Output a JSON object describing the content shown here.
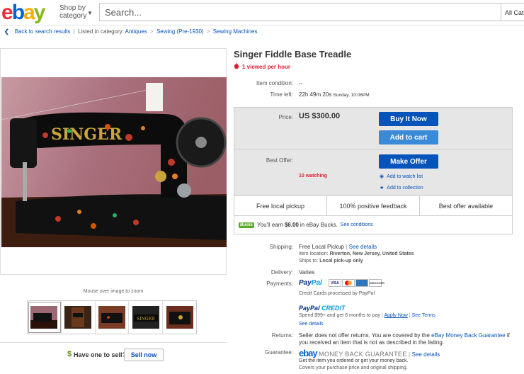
{
  "header": {
    "logo_letters": [
      "e",
      "b",
      "a",
      "y"
    ],
    "logo_colors": [
      "#e53238",
      "#0064d2",
      "#f5af02",
      "#86b817"
    ],
    "shop_by_line1": "Shop by",
    "shop_by_line2": "category",
    "search_placeholder": "Search...",
    "category_select": "All Cate"
  },
  "breadcrumb": {
    "back_label": "Back to search results",
    "listed_in": "Listed in category:",
    "items": [
      "Antiques",
      "Sewing (Pre-1930)",
      "Sewing Machines"
    ]
  },
  "gallery": {
    "zoom_hint": "Mouse over image to zoom",
    "thumbnails": [
      "thumb-1",
      "thumb-2",
      "thumb-3",
      "thumb-4",
      "thumb-5"
    ]
  },
  "sell": {
    "dollar": "$",
    "prompt": "Have one to sell?",
    "button": "Sell now"
  },
  "listing": {
    "title": "Singer Fiddle Base Treadle",
    "viewed": "1 viewed per hour",
    "condition_label": "Item condition:",
    "condition_value": "--",
    "time_left_label": "Time left:",
    "time_left_value": "22h 49m 20s",
    "time_left_end": "Sunday, 10:06PM"
  },
  "buybox": {
    "price_label": "Price:",
    "price_value": "US $300.00",
    "buy_now": "Buy It Now",
    "add_to_cart": "Add to cart",
    "best_offer_label": "Best Offer:",
    "make_offer": "Make Offer",
    "watching": "10 watching",
    "add_watch": "Add to watch list",
    "add_collection": "Add to collection"
  },
  "features": [
    "Free local pickup",
    "100% positive feedback",
    "Best offer available"
  ],
  "bucks": {
    "logo": "Bucks",
    "text_pre": "You'll earn ",
    "amount": "$6.00",
    "text_post": " in eBay Bucks.",
    "link": "See conditions"
  },
  "details": {
    "shipping_label": "Shipping:",
    "shipping_value": "Free Local Pickup",
    "see_details": "See details",
    "item_location_label": "Item location:",
    "item_location_value": "Riverton, New Jersey, United States",
    "ships_to_label": "Ships to:",
    "ships_to_value": "Local pick-up only",
    "delivery_label": "Delivery:",
    "delivery_value": "Varies",
    "payments_label": "Payments:",
    "paypal_pay": "Pay",
    "paypal_pal": "Pal",
    "cards_label": "Credit Cards processed by PayPal",
    "card_names": [
      "VISA",
      "MC",
      "AMEX",
      "DISCOVER"
    ],
    "credit_pay": "PayPal",
    "credit_word": "CREDIT",
    "credit_text": "Spend $99+ and get 6 months to pay",
    "apply_now": "Apply Now",
    "see_terms": "See Terms",
    "credit_see_details": "See details",
    "returns_label": "Returns:",
    "returns_pre": "Seller does not offer returns. You are covered by the ",
    "returns_link": "eBay Money Back Guarantee",
    "returns_post": " if you received an item that is not as described in the listing.",
    "guarantee_label": "Guarantee:",
    "guarantee_logo": "ebay",
    "guarantee_title": "MONEY BACK GUARANTEE",
    "guarantee_see": "See details",
    "guarantee_line1": "Get the item you ordered or get your money back.",
    "guarantee_line2": "Covers your purchase price and original shipping."
  },
  "colors": {
    "link": "#0654ba",
    "alert": "#dd1e31",
    "button_primary": "#0654ba",
    "button_secondary": "#3a8ad8"
  }
}
